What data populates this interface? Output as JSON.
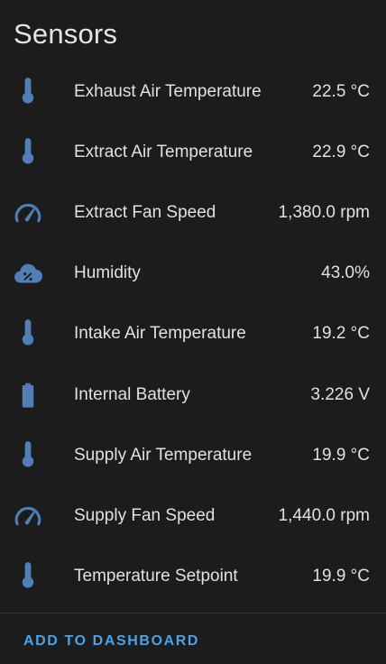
{
  "card": {
    "title": "Sensors",
    "action_label": "ADD TO DASHBOARD"
  },
  "colors": {
    "background": "#1c1c1c",
    "text": "#e1e1e1",
    "icon": "#4f7fb5",
    "accent": "#4aa3e8",
    "divider": "#353535"
  },
  "sensors": [
    {
      "icon": "thermometer-icon",
      "name": "Exhaust Air Temperature",
      "value": "22.5 °C"
    },
    {
      "icon": "thermometer-icon",
      "name": "Extract Air Temperature",
      "value": "22.9 °C"
    },
    {
      "icon": "speedometer-icon",
      "name": "Extract Fan Speed",
      "value": "1,380.0 rpm"
    },
    {
      "icon": "cloud-percent-icon",
      "name": "Humidity",
      "value": "43.0%"
    },
    {
      "icon": "thermometer-icon",
      "name": "Intake Air Temperature",
      "value": "19.2 °C"
    },
    {
      "icon": "battery-icon",
      "name": "Internal Battery",
      "value": "3.226 V"
    },
    {
      "icon": "thermometer-icon",
      "name": "Supply Air Temperature",
      "value": "19.9 °C"
    },
    {
      "icon": "speedometer-icon",
      "name": "Supply Fan Speed",
      "value": "1,440.0 rpm"
    },
    {
      "icon": "thermometer-icon",
      "name": "Temperature Setpoint",
      "value": "19.9 °C"
    }
  ]
}
